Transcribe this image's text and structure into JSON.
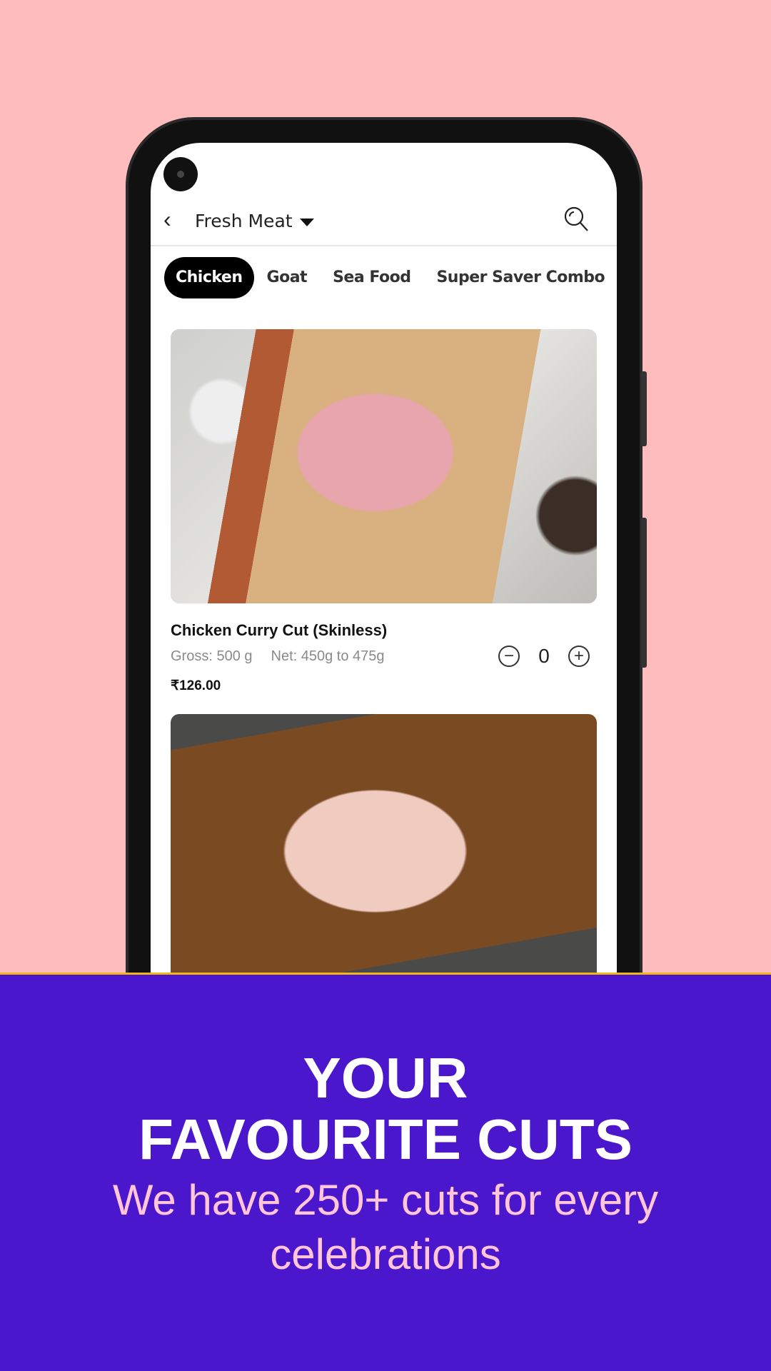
{
  "header": {
    "title": "Fresh Meat",
    "back_icon": "chevron-left-icon",
    "search_icon": "search-icon"
  },
  "tabs": [
    {
      "label": "Chicken",
      "active": true
    },
    {
      "label": "Goat"
    },
    {
      "label": "Sea Food"
    },
    {
      "label": "Super Saver Combo"
    }
  ],
  "products": [
    {
      "name": "Chicken Curry Cut (Skinless)",
      "gross": "Gross: 500 g",
      "net": "Net: 450g to 475g",
      "price": "₹126.00",
      "quantity": "0"
    },
    {}
  ],
  "banner": {
    "line1": "YOUR",
    "line2": "FAVOURITE CUTS",
    "subtitle1": "We have 250+ cuts for every",
    "subtitle2": "celebrations"
  },
  "colors": {
    "background": "#ffbcbc",
    "banner": "#4b17cc",
    "accent_line": "#f2b619",
    "subtitle": "#ffc6d8"
  }
}
